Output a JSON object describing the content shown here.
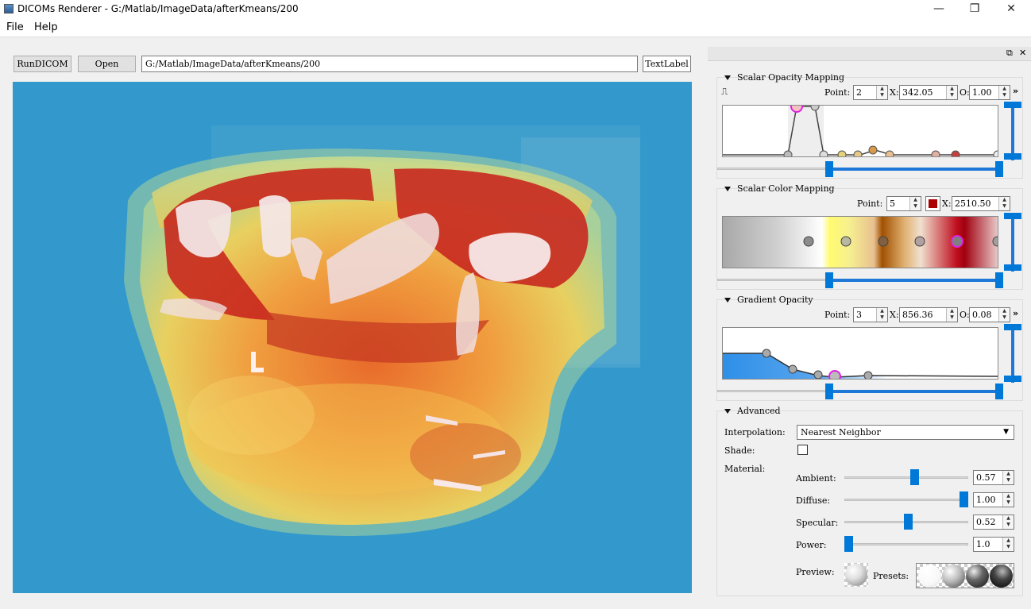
{
  "window": {
    "title": "DICOMs Renderer - G:/Matlab/ImageData/afterKmeans/200",
    "minimize": "—",
    "restore": "❐",
    "close": "✕"
  },
  "menu": {
    "file": "File",
    "help": "Help"
  },
  "toolbar": {
    "run_label": "RunDICOM",
    "open_label": "Open",
    "path_value": "G:/Matlab/ImageData/afterKmeans/200",
    "text_label": "TextLabel"
  },
  "dock": {
    "float_icon": "⧉",
    "close_icon": "✕"
  },
  "scalar_opacity": {
    "title": "Scalar Opacity Mapping",
    "point_label": "Point:",
    "point_value": "2",
    "x_label": "X:",
    "x_value": "342.05",
    "o_label": "O:",
    "o_value": "1.00",
    "more": "»"
  },
  "scalar_color": {
    "title": "Scalar Color Mapping",
    "point_label": "Point:",
    "point_value": "5",
    "x_label": "X:",
    "x_value": "2510.50",
    "swatch_color": "#aa0000"
  },
  "gradient_opacity": {
    "title": "Gradient Opacity",
    "point_label": "Point:",
    "point_value": "3",
    "x_label": "X:",
    "x_value": "856.36",
    "o_label": "O:",
    "o_value": "0.08",
    "more": "»"
  },
  "advanced": {
    "title": "Advanced",
    "interpolation_label": "Interpolation:",
    "interpolation_value": "Nearest Neighbor",
    "shade_label": "Shade:",
    "shade_checked": false,
    "material_label": "Material:",
    "ambient_label": "Ambient:",
    "ambient_value": "0.57",
    "diffuse_label": "Diffuse:",
    "diffuse_value": "1.00",
    "specular_label": "Specular:",
    "specular_value": "0.52",
    "power_label": "Power:",
    "power_value": "1.0",
    "preview_label": "Preview:",
    "presets_label": "Presets:"
  },
  "colors": {
    "accent": "#0078d7",
    "viewport_bg": "#3399cc",
    "selected_point": "#e020e0"
  }
}
